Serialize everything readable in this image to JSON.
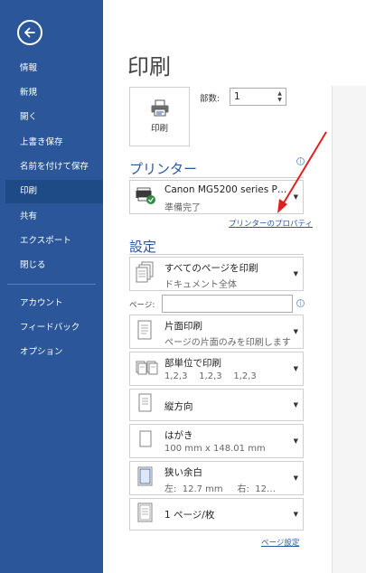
{
  "sidebar": {
    "items": [
      {
        "label": "情報"
      },
      {
        "label": "新規"
      },
      {
        "label": "開く"
      },
      {
        "label": "上書き保存"
      },
      {
        "label": "名前を付けて保存"
      },
      {
        "label": "印刷"
      },
      {
        "label": "共有"
      },
      {
        "label": "エクスポート"
      },
      {
        "label": "閉じる"
      },
      {
        "label": "アカウント"
      },
      {
        "label": "フィードバック"
      },
      {
        "label": "オプション"
      }
    ]
  },
  "main": {
    "title": "印刷",
    "print_button_label": "印刷",
    "copies_label": "部数:",
    "copies_value": "1",
    "printer_section": "プリンター",
    "printer_name": "Canon MG5200 series P…",
    "printer_status": "準備完了",
    "printer_properties_link": "プリンターのプロパティ",
    "settings_section": "設定",
    "pages_label": "ページ:",
    "pages_value": "",
    "page_setup_link": "ページ設定",
    "settings": [
      {
        "line1": "すべてのページを印刷",
        "line2": "ドキュメント全体",
        "icon": "pages-icon"
      },
      {
        "line1": "片面印刷",
        "line2": "ページの片面のみを印刷します",
        "icon": "single-side-icon"
      },
      {
        "line1": "部単位で印刷",
        "line2": "1,2,3    1,2,3    1,2,3",
        "icon": "collate-icon"
      },
      {
        "line1": "縦方向",
        "line2": "",
        "icon": "portrait-icon"
      },
      {
        "line1": "はがき",
        "line2": "100 mm x 148.01 mm",
        "icon": "paper-size-icon"
      },
      {
        "line1": "狭い余白",
        "line2": "左:  12.7 mm     右:  12…",
        "icon": "margins-icon"
      },
      {
        "line1": "1 ページ/枚",
        "line2": "",
        "icon": "pages-per-sheet-icon"
      }
    ]
  },
  "colors": {
    "sidebar_bg": "#2b579a",
    "sidebar_active": "#1e4a85",
    "accent": "#2b579a",
    "annotation_arrow": "#e0201e"
  }
}
